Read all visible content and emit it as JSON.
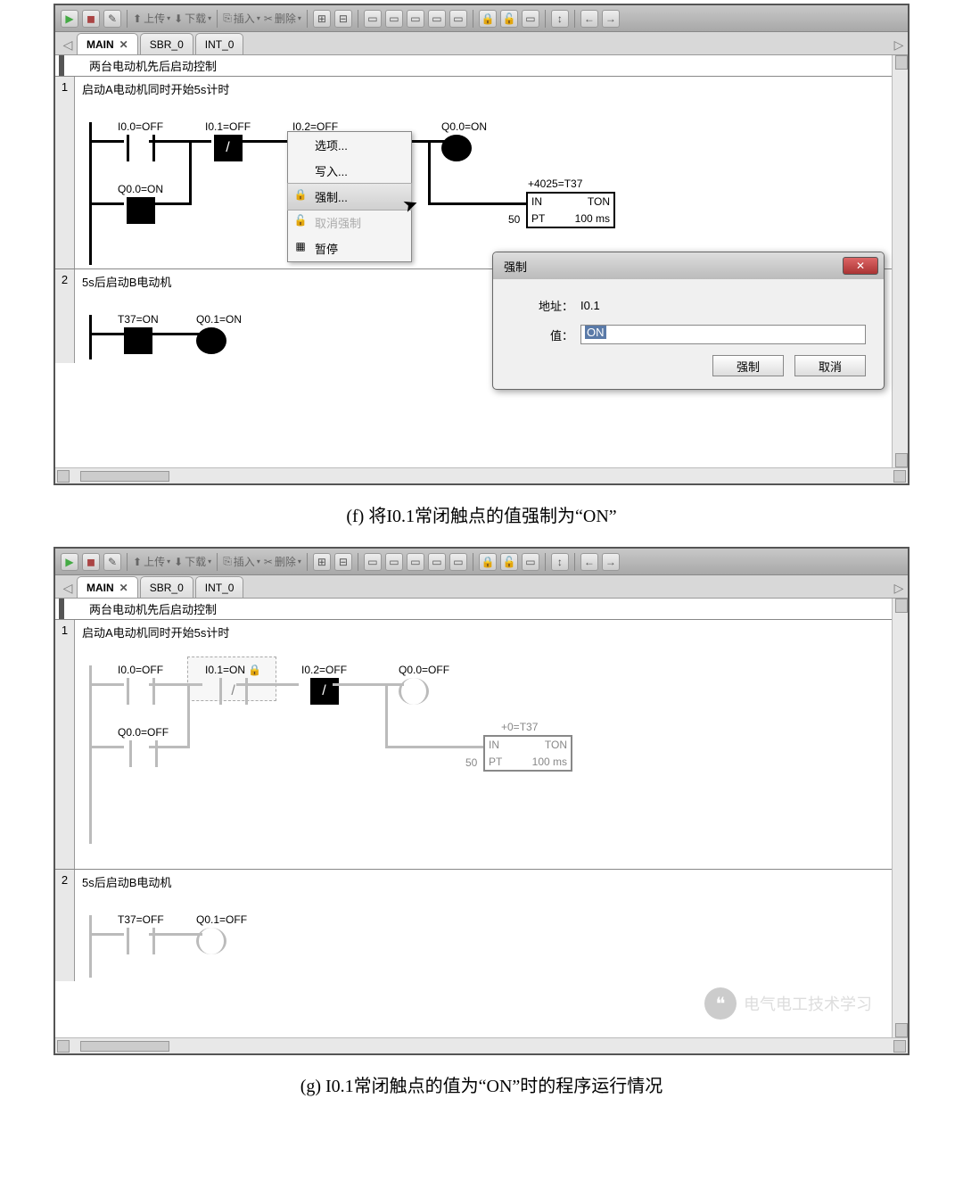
{
  "toolbar": {
    "upload": "上传",
    "download": "下载",
    "insert": "插入",
    "delete": "删除"
  },
  "tabs": {
    "main": "MAIN",
    "sbr": "SBR_0",
    "int": "INT_0"
  },
  "prog_title": "两台电动机先后启动控制",
  "net1_comment": "启动A电动机同时开始5s计时",
  "net2_comment": "5s后启动B电动机",
  "f": {
    "i00": "I0.0=OFF",
    "i01": "I0.1=OFF",
    "i02": "I0.2=OFF",
    "q00_coil": "Q0.0=ON",
    "q00_contact": "Q0.0=ON",
    "timer_top": "+4025=T37",
    "t_in": "IN",
    "t_ton": "TON",
    "t_pt": "PT",
    "t_ms": "100 ms",
    "t_left": "50",
    "n2_t37": "T37=ON",
    "n2_q01": "Q0.1=ON"
  },
  "g": {
    "i00": "I0.0=OFF",
    "i01": "I0.1=ON",
    "i02": "I0.2=OFF",
    "q00_coil": "Q0.0=OFF",
    "q00_contact": "Q0.0=OFF",
    "timer_top": "+0=T37",
    "t_in": "IN",
    "t_ton": "TON",
    "t_pt": "PT",
    "t_ms": "100 ms",
    "t_left": "50",
    "n2_t37": "T37=OFF",
    "n2_q01": "Q0.1=OFF"
  },
  "ctx": {
    "options": "选项...",
    "write": "写入...",
    "force": "强制...",
    "unforce": "取消强制",
    "pause": "暂停"
  },
  "dialog": {
    "title": "强制",
    "addr_lab": "地址：",
    "addr_val": "I0.1",
    "val_lab": "值：",
    "val_val": "ON",
    "force_btn": "强制",
    "cancel_btn": "取消"
  },
  "captions": {
    "f": "(f)  将I0.1常闭触点的值强制为“ON”",
    "g": "(g)  I0.1常闭触点的值为“ON”时的程序运行情况"
  },
  "watermark": "电气电工技术学习",
  "net_numbers": {
    "n1": "1",
    "n2": "2"
  }
}
